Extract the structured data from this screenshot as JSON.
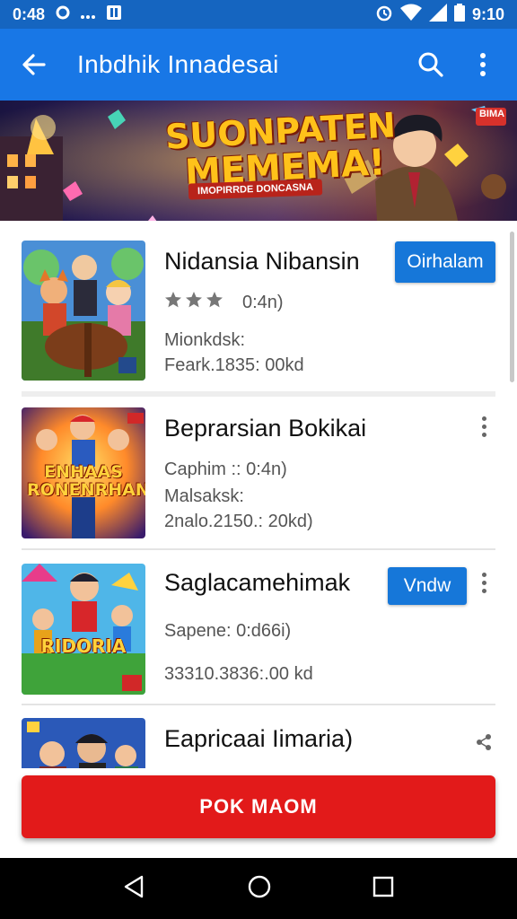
{
  "status_bar": {
    "time": "0:48",
    "right_time": "9:10"
  },
  "app_bar": {
    "title": "Inbdhik Innadesai"
  },
  "banner": {
    "headline_1": "SUONPATEN",
    "headline_2": "MEMEMA!",
    "subtitle": "IMOPIRRDE DONCASNA",
    "corner_badge": "BIMA"
  },
  "games": [
    {
      "title": "Nidansia Nibansin",
      "rating_text": "0:4n)",
      "stars_filled": 3,
      "meta_1": "Mionkdsk:",
      "meta_2": "Feark.1835: 00kd",
      "button_label": "Oirhalam"
    },
    {
      "title": "Beprarsian Bokikai",
      "meta_1": "Caphim :: 0:4n)",
      "meta_2": "Malsaksk:",
      "meta_3": "2nalo.2150.: 20kd)",
      "thumb_text": "ENHAAS RONENRHAN"
    },
    {
      "title": "Saglacamehimak",
      "meta_1": "Sapene: 0:d66i)",
      "meta_2": "33310.3836:.00 kd",
      "button_label": "Vndw",
      "thumb_text": "RIDORIA"
    },
    {
      "title": "Eapricaai Iimaria)"
    }
  ],
  "cta": {
    "label": "POK MAOM"
  },
  "colors": {
    "primary": "#1877e6",
    "status": "#1565c0",
    "cta": "#e21a1a"
  }
}
